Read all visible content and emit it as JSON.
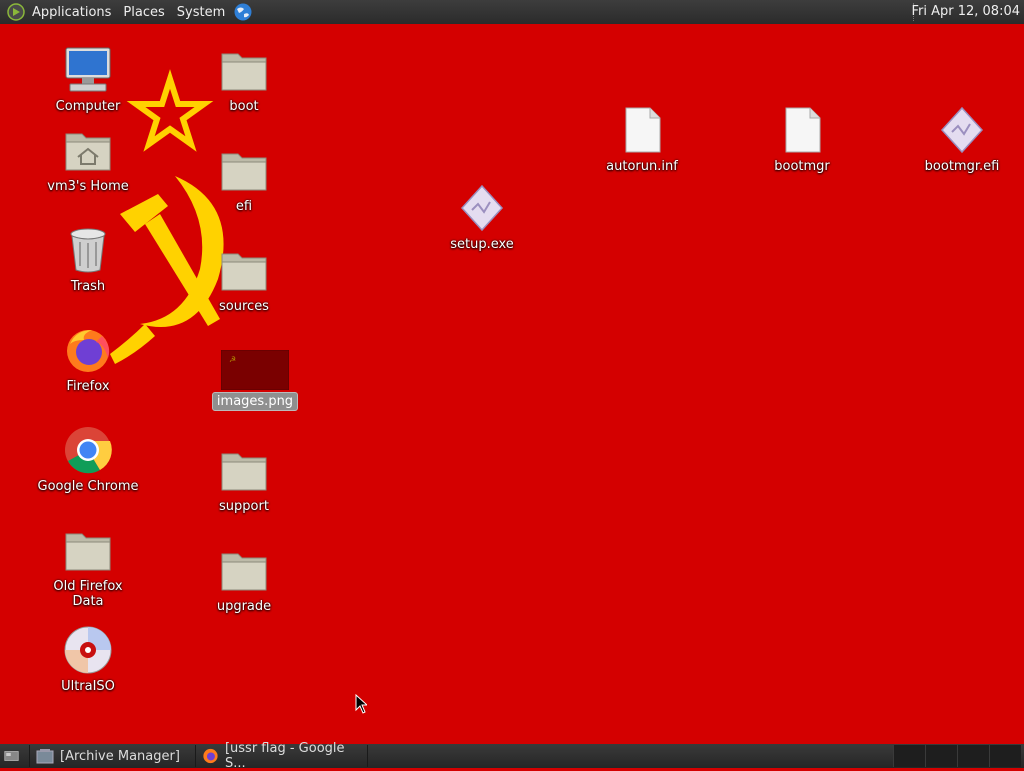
{
  "top_panel": {
    "menus": [
      "Applications",
      "Places",
      "System"
    ],
    "clock": "Fri Apr 12, 08:04"
  },
  "desktop": {
    "icons": [
      {
        "label": "Computer",
        "icon": "computer-icon"
      },
      {
        "label": "vm3's Home",
        "icon": "home-folder-icon"
      },
      {
        "label": "Trash",
        "icon": "trash-icon"
      },
      {
        "label": "Firefox",
        "icon": "firefox-icon"
      },
      {
        "label": "Google Chrome",
        "icon": "chrome-icon"
      },
      {
        "label": "Old Firefox Data",
        "icon": "folder-icon"
      },
      {
        "label": "UltraISO",
        "icon": "ultraiso-icon"
      },
      {
        "label": "boot",
        "icon": "folder-icon"
      },
      {
        "label": "efi",
        "icon": "folder-icon"
      },
      {
        "label": "sources",
        "icon": "folder-icon"
      },
      {
        "label": "images.png",
        "icon": "image-thumbnail-icon",
        "selected": true
      },
      {
        "label": "support",
        "icon": "folder-icon"
      },
      {
        "label": "upgrade",
        "icon": "folder-icon"
      },
      {
        "label": "setup.exe",
        "icon": "executable-icon"
      },
      {
        "label": "autorun.inf",
        "icon": "text-file-icon"
      },
      {
        "label": "bootmgr",
        "icon": "text-file-icon"
      },
      {
        "label": "bootmgr.efi",
        "icon": "executable-icon"
      }
    ]
  },
  "taskbar": {
    "tasks": [
      {
        "label": "[Archive Manager]",
        "icon": "archive-manager-icon"
      },
      {
        "label": "[ussr flag - Google S...",
        "icon": "firefox-icon"
      }
    ]
  },
  "colors": {
    "wallpaper": "#d40000",
    "emblem": "#ffd200",
    "panel": "#2e2e2e"
  }
}
